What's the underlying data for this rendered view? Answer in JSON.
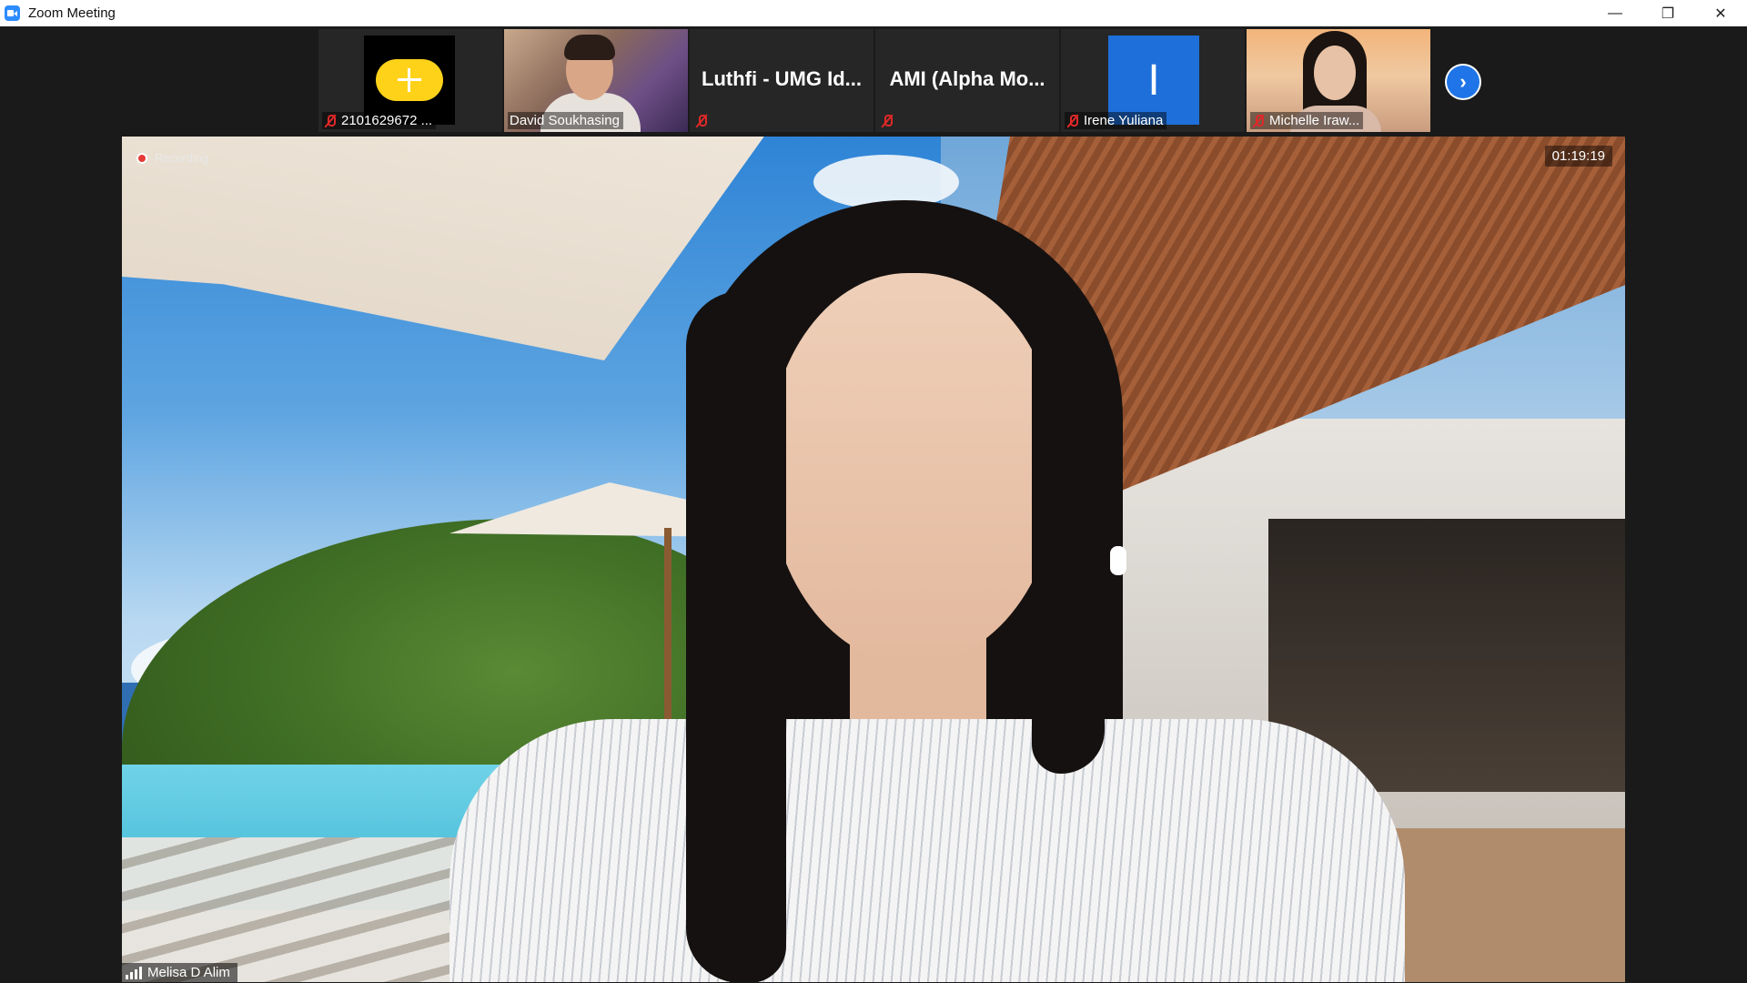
{
  "window": {
    "title": "Zoom Meeting",
    "controls": {
      "minimize": "—",
      "restore": "❐",
      "close": "✕"
    }
  },
  "participants": [
    {
      "name": "2101629672 ...",
      "display": "avatar",
      "muted": true,
      "avatar_color": "#ffd21a"
    },
    {
      "name": "David Soukhasing",
      "display": "video",
      "muted": false
    },
    {
      "name": "Luthfi - UMG Id...",
      "display": "name-only",
      "muted": true
    },
    {
      "name": "AMI (Alpha Mo...",
      "display": "name-only",
      "muted": true
    },
    {
      "name": "Irene Yuliana",
      "display": "avatar",
      "avatar_letter": "I",
      "muted": true,
      "avatar_color": "#1e6fd9"
    },
    {
      "name": "Michelle Iraw...",
      "display": "video",
      "muted": true
    }
  ],
  "strip": {
    "next_icon": "chevron-right-icon",
    "next_glyph": "›"
  },
  "main_video": {
    "recording_label": "Recording",
    "timer": "01:19:19",
    "speaker_name": "Melisa D Alim"
  },
  "colors": {
    "accent": "#1f74e8",
    "muted": "#e02828",
    "recording": "#e53935"
  }
}
